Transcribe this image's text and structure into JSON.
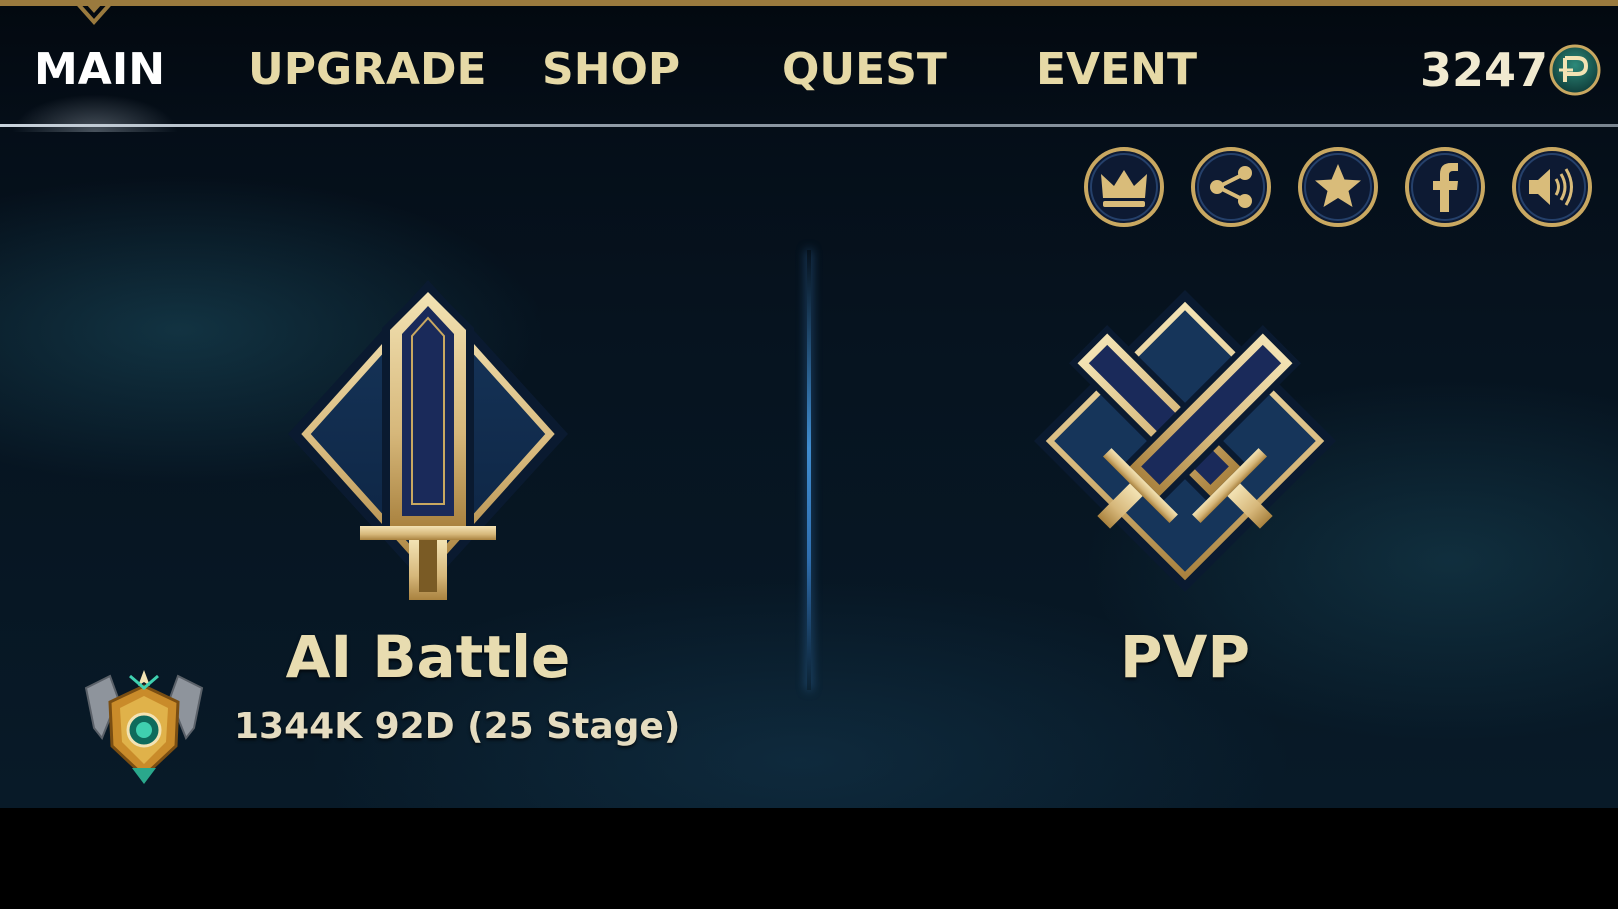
{
  "nav": {
    "tabs": [
      {
        "label": "MAIN",
        "active": true
      },
      {
        "label": "UPGRADE",
        "active": false
      },
      {
        "label": "SHOP",
        "active": false
      },
      {
        "label": "QUEST",
        "active": false
      },
      {
        "label": "EVENT",
        "active": false
      }
    ],
    "currency": {
      "value": "3247",
      "icon": "coin-icon"
    }
  },
  "actions": [
    {
      "icon": "crown-icon",
      "meaning": "leaderboard"
    },
    {
      "icon": "share-icon",
      "meaning": "share"
    },
    {
      "icon": "star-icon",
      "meaning": "rate"
    },
    {
      "icon": "facebook-icon",
      "meaning": "facebook"
    },
    {
      "icon": "speaker-icon",
      "meaning": "sound"
    }
  ],
  "modes": {
    "ai": {
      "title": "AI Battle",
      "progress": "1344K 92D (25 Stage)",
      "icon": "sword-icon"
    },
    "pvp": {
      "title": "PVP",
      "icon": "crossed-swords-icon"
    }
  },
  "colors": {
    "gold": "#c9a861",
    "gold_light": "#f3e3b4",
    "navy": "#1a2a5a",
    "text_gold": "#e6d9a6",
    "divider_blue": "#3f8ccf"
  }
}
